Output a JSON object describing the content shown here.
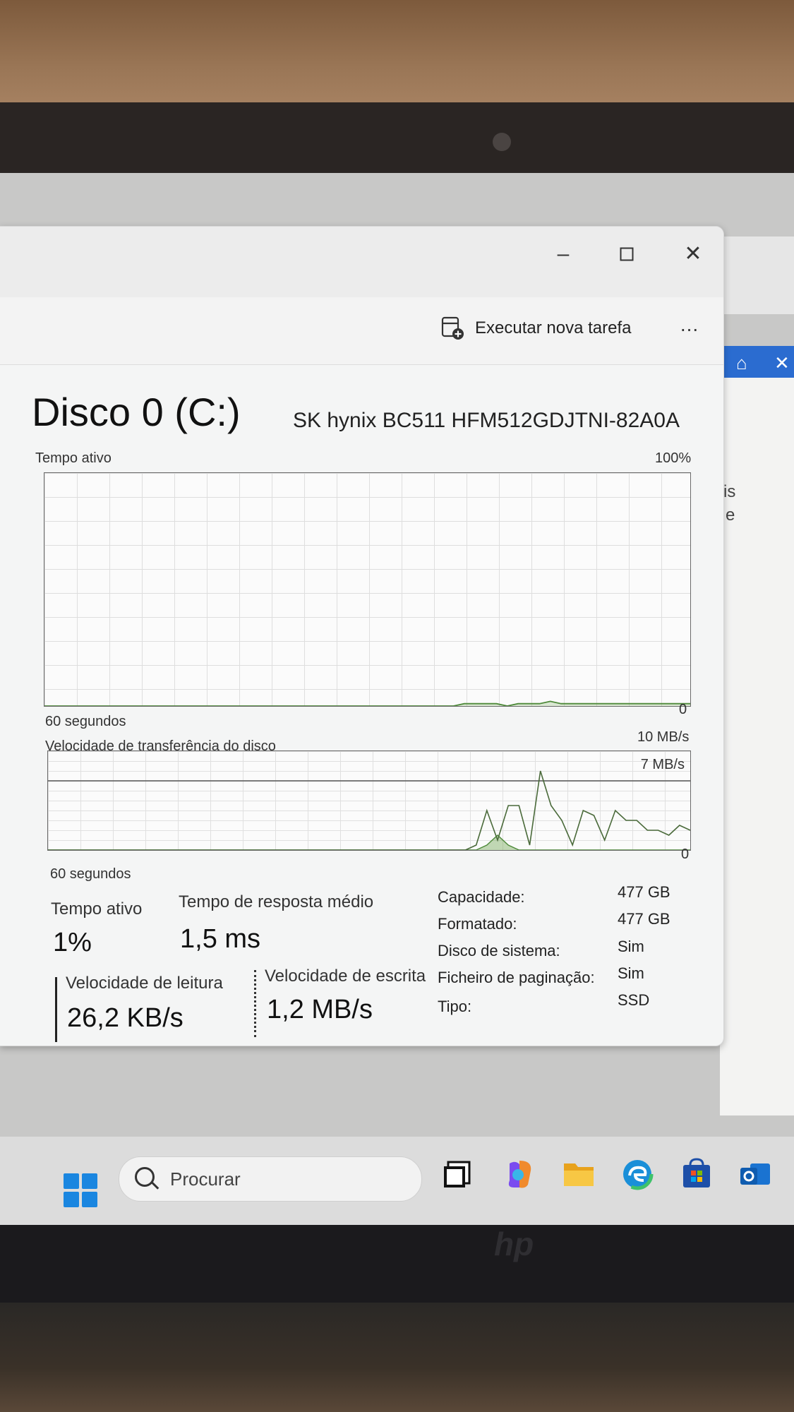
{
  "window": {
    "minimize_icon": "minimize-icon",
    "maximize_icon": "maximize-icon",
    "close_icon": "close-icon"
  },
  "toolbar": {
    "run_task_label": "Executar nova tarefa",
    "more_label": "..."
  },
  "disk": {
    "title": "Disco 0 (C:)",
    "model": "SK hynix BC511 HFM512GDJTNI-82A0A"
  },
  "graph_active": {
    "label": "Tempo ativo",
    "max": "100%",
    "min": "0",
    "time": "60 segundos"
  },
  "graph_transfer": {
    "label": "Velocidade de transferência do disco",
    "max": "10 MB/s",
    "line_label": "7 MB/s",
    "min": "0",
    "time": "60 segundos"
  },
  "stats": {
    "active_label": "Tempo ativo",
    "active_value": "1%",
    "response_label": "Tempo de resposta médio",
    "response_value": "1,5 ms",
    "read_label": "Velocidade de leitura",
    "read_value": "26,2 KB/s",
    "write_label": "Velocidade de escrita",
    "write_value": "1,2 MB/s"
  },
  "info": [
    {
      "label": "Capacidade:",
      "value": "477 GB"
    },
    {
      "label": "Formatado:",
      "value": "477 GB"
    },
    {
      "label": "Disco de sistema:",
      "value": "Sim"
    },
    {
      "label": "Ficheiro de paginação:",
      "value": "Sim"
    },
    {
      "label": "Tipo:",
      "value": "SSD"
    }
  ],
  "background": {
    "text_1": "is",
    "text_2": "e"
  },
  "taskbar": {
    "search_placeholder": "Procurar"
  },
  "colors": {
    "graph_line": "#4e8a3a",
    "graph_border": "#6a6a6a",
    "start_blue": "#1a86e0"
  },
  "chart_data": [
    {
      "type": "area",
      "title": "Tempo ativo",
      "ylim": [
        0,
        100
      ],
      "xlabel": "60 segundos",
      "ylabel": "",
      "values": [
        0,
        0,
        0,
        0,
        0,
        0,
        0,
        0,
        0,
        0,
        0,
        0,
        0,
        0,
        0,
        0,
        0,
        0,
        0,
        0,
        0,
        0,
        0,
        0,
        0,
        0,
        0,
        0,
        0,
        0,
        0,
        0,
        0,
        0,
        0,
        0,
        0,
        0,
        0,
        1,
        1,
        1,
        1,
        0,
        1,
        1,
        1,
        2,
        1,
        1,
        1,
        1,
        1,
        1,
        1,
        1,
        1,
        1,
        1,
        1,
        1
      ]
    },
    {
      "type": "line",
      "title": "Velocidade de transferência do disco",
      "ylim": [
        0,
        10
      ],
      "xlabel": "60 segundos",
      "ylabel": "",
      "reference_line": 7,
      "series": [
        {
          "values": [
            0,
            0,
            0,
            0,
            0,
            0,
            0,
            0,
            0,
            0,
            0,
            0,
            0,
            0,
            0,
            0,
            0,
            0,
            0,
            0,
            0,
            0,
            0,
            0,
            0,
            0,
            0,
            0,
            0,
            0,
            0,
            0,
            0,
            0,
            0,
            0,
            0,
            0,
            0,
            0,
            0.5,
            4,
            1,
            4.5,
            4.5,
            0.5,
            8,
            4.5,
            3,
            0.5,
            4,
            3.5,
            1,
            4,
            3,
            3,
            2,
            2,
            1.5,
            2.5,
            2
          ]
        },
        {
          "values": [
            0,
            0,
            0,
            0,
            0,
            0,
            0,
            0,
            0,
            0,
            0,
            0,
            0,
            0,
            0,
            0,
            0,
            0,
            0,
            0,
            0,
            0,
            0,
            0,
            0,
            0,
            0,
            0,
            0,
            0,
            0,
            0,
            0,
            0,
            0,
            0,
            0,
            0,
            0,
            0,
            0,
            0.5,
            1.5,
            0.5,
            0,
            0,
            0,
            0,
            0,
            0,
            0,
            0,
            0,
            0,
            0,
            0,
            0,
            0,
            0,
            0,
            0
          ]
        }
      ]
    }
  ]
}
